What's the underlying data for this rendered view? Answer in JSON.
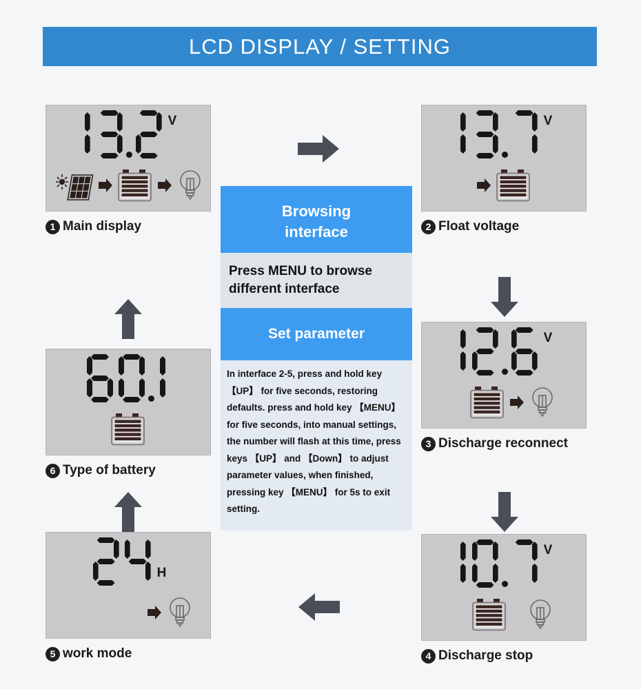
{
  "header": {
    "title": "LCD DISPLAY / SETTING",
    "banner_color": "#3288ce"
  },
  "theme": {
    "page_background": "#f5f6f8",
    "lcd_background": "#c9c9cb",
    "arrow_color": "#4a4e57",
    "blue_band": "#3d9bf0",
    "gray_band": "#dfe4e9",
    "note_band": "#e3eaf1",
    "digit_color": "#161617"
  },
  "panels": [
    {
      "id": "main-display",
      "number": "1",
      "caption": "Main display",
      "value": "13.2",
      "unit": "V",
      "icons": [
        "solar-panel-icon",
        "arrow-right-icon",
        "battery-icon",
        "arrow-right-icon",
        "light-bulb-icon"
      ]
    },
    {
      "id": "float-voltage",
      "number": "2",
      "caption": "Float voltage",
      "value": "13.7",
      "unit": "V",
      "icons": [
        "arrow-right-icon",
        "battery-icon"
      ]
    },
    {
      "id": "discharge-reconnect",
      "number": "3",
      "caption": "Discharge reconnect",
      "value": "12.6",
      "unit": "V",
      "icons": [
        "battery-icon",
        "arrow-right-icon",
        "light-bulb-icon"
      ]
    },
    {
      "id": "discharge-stop",
      "number": "4",
      "caption": "Discharge stop",
      "value": "10.7",
      "unit": "V",
      "icons": [
        "battery-icon",
        "light-bulb-icon"
      ]
    },
    {
      "id": "work-mode",
      "number": "5",
      "caption": "work mode",
      "value": "24",
      "unit": "H",
      "icons": [
        "arrow-right-icon",
        "light-bulb-icon"
      ]
    },
    {
      "id": "type-of-battery",
      "number": "6",
      "caption": "Type of battery",
      "value": "60.1",
      "unit": "",
      "icons": [
        "battery-icon"
      ]
    }
  ],
  "center": {
    "browsing_title_line1": "Browsing",
    "browsing_title_line2": "interface",
    "browse_instruction": "Press MENU to browse different interface",
    "set_parameter_title": "Set parameter",
    "set_parameter_note": "In interface 2-5, press and hold key 【UP】 for five seconds, restoring defaults. press and hold  key 【MENU】 for five seconds, into manual settings, the number will flash at this time, press keys 【UP】 and 【Down】 to adjust  parameter values, when finished, pressing  key 【MENU】 for 5s to exit  setting."
  },
  "flow_arrows": [
    {
      "id": "flow-arrow-top-right",
      "direction": "right"
    },
    {
      "id": "flow-arrow-right-upper",
      "direction": "down"
    },
    {
      "id": "flow-arrow-right-lower",
      "direction": "down"
    },
    {
      "id": "flow-arrow-bottom-left",
      "direction": "left"
    },
    {
      "id": "flow-arrow-left-lower",
      "direction": "up"
    },
    {
      "id": "flow-arrow-left-upper",
      "direction": "up"
    }
  ]
}
